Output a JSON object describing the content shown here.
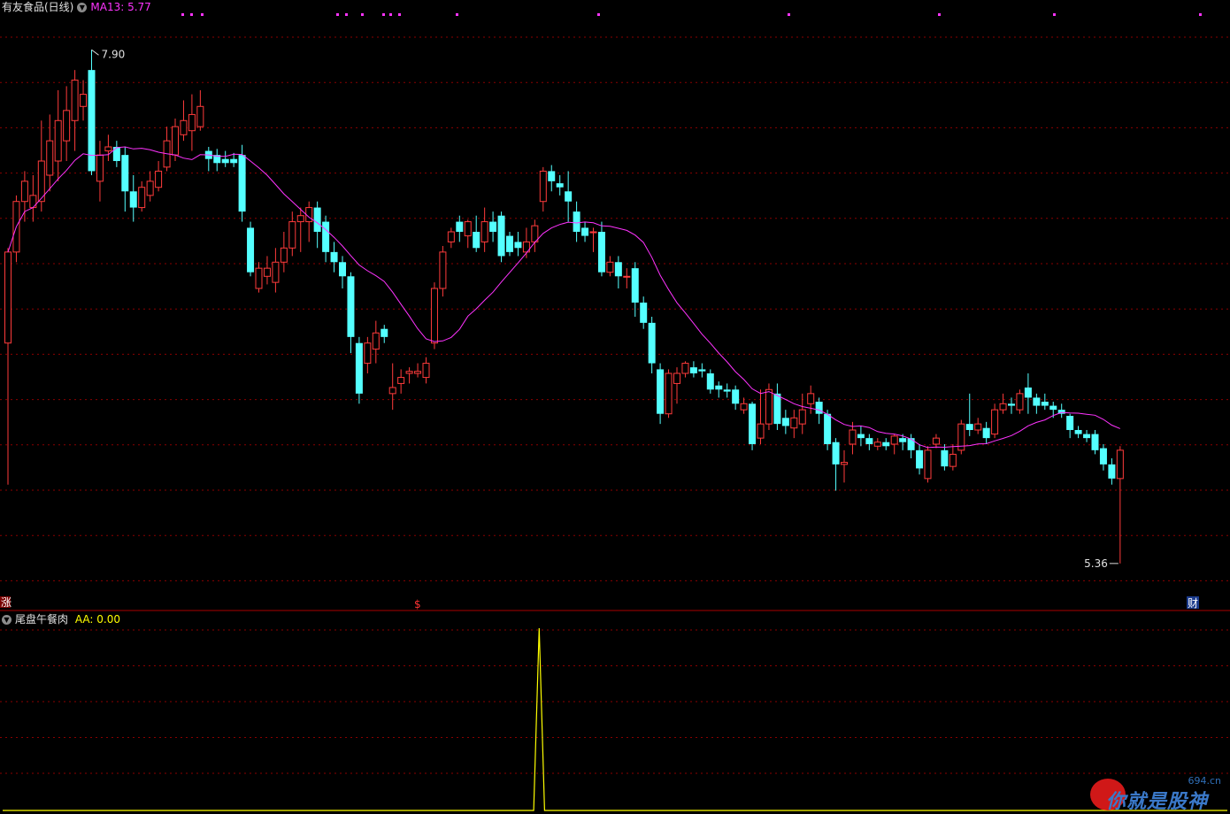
{
  "header": {
    "stock_title": "有友食品(日线)",
    "ma_label": "MA13: 5.77",
    "indicator_name": "尾盘午餐肉",
    "indicator_value": "AA: 0.00"
  },
  "markers": {
    "high_label": "7.90",
    "low_label": "5.36",
    "left_mark": "涨",
    "mid_mark": "$",
    "right_mark": "财"
  },
  "watermark": {
    "site": "694.cn",
    "text": "你就是股神"
  },
  "colors": {
    "up": "#ff3b3b",
    "down": "#54ffff",
    "ma": "#ff33ff",
    "indicator": "#ffff00",
    "grid": "#8b0000",
    "separator": "#aa0000"
  },
  "chart_data": [
    {
      "type": "candlestick",
      "title": "有友食品(日线)",
      "ylim": [
        5.25,
        8.05
      ],
      "ma13_last": 5.77,
      "candles": [
        {
          "o": 6.45,
          "c": 6.9,
          "h": 6.92,
          "l": 5.75
        },
        {
          "o": 6.9,
          "c": 7.15,
          "h": 7.18,
          "l": 6.85
        },
        {
          "o": 7.15,
          "c": 7.25,
          "h": 7.3,
          "l": 7.05
        },
        {
          "o": 7.12,
          "c": 7.18,
          "h": 7.28,
          "l": 7.05
        },
        {
          "o": 7.15,
          "c": 7.35,
          "h": 7.55,
          "l": 7.1
        },
        {
          "o": 7.28,
          "c": 7.45,
          "h": 7.58,
          "l": 7.2
        },
        {
          "o": 7.35,
          "c": 7.55,
          "h": 7.7,
          "l": 7.25
        },
        {
          "o": 7.45,
          "c": 7.6,
          "h": 7.72,
          "l": 7.35
        },
        {
          "o": 7.55,
          "c": 7.75,
          "h": 7.8,
          "l": 7.4
        },
        {
          "o": 7.62,
          "c": 7.68,
          "h": 7.75,
          "l": 7.55
        },
        {
          "o": 7.8,
          "c": 7.3,
          "h": 7.9,
          "l": 7.28
        },
        {
          "o": 7.25,
          "c": 7.38,
          "h": 7.45,
          "l": 7.15
        },
        {
          "o": 7.4,
          "c": 7.42,
          "h": 7.48,
          "l": 7.35
        },
        {
          "o": 7.42,
          "c": 7.35,
          "h": 7.45,
          "l": 7.32
        },
        {
          "o": 7.38,
          "c": 7.2,
          "h": 7.42,
          "l": 7.1
        },
        {
          "o": 7.2,
          "c": 7.12,
          "h": 7.28,
          "l": 7.05
        },
        {
          "o": 7.12,
          "c": 7.22,
          "h": 7.25,
          "l": 7.1
        },
        {
          "o": 7.18,
          "c": 7.25,
          "h": 7.3,
          "l": 7.15
        },
        {
          "o": 7.22,
          "c": 7.3,
          "h": 7.35,
          "l": 7.2
        },
        {
          "o": 7.32,
          "c": 7.45,
          "h": 7.52,
          "l": 7.3
        },
        {
          "o": 7.38,
          "c": 7.52,
          "h": 7.56,
          "l": 7.35
        },
        {
          "o": 7.48,
          "c": 7.55,
          "h": 7.65,
          "l": 7.45
        },
        {
          "o": 7.5,
          "c": 7.58,
          "h": 7.68,
          "l": 7.4
        },
        {
          "o": 7.52,
          "c": 7.62,
          "h": 7.7,
          "l": 7.5
        },
        {
          "o": 7.4,
          "c": 7.36,
          "h": 7.42,
          "l": 7.3
        },
        {
          "o": 7.38,
          "c": 7.34,
          "h": 7.41,
          "l": 7.3
        },
        {
          "o": 7.36,
          "c": 7.34,
          "h": 7.4,
          "l": 7.32
        },
        {
          "o": 7.36,
          "c": 7.34,
          "h": 7.39,
          "l": 7.32
        },
        {
          "o": 7.38,
          "c": 7.1,
          "h": 7.43,
          "l": 7.05
        },
        {
          "o": 7.02,
          "c": 6.8,
          "h": 7.05,
          "l": 6.78
        },
        {
          "o": 6.72,
          "c": 6.82,
          "h": 6.85,
          "l": 6.7
        },
        {
          "o": 6.78,
          "c": 6.82,
          "h": 6.88,
          "l": 6.74
        },
        {
          "o": 6.75,
          "c": 6.85,
          "h": 6.92,
          "l": 6.7
        },
        {
          "o": 6.85,
          "c": 6.92,
          "h": 7.0,
          "l": 6.8
        },
        {
          "o": 6.92,
          "c": 7.05,
          "h": 7.1,
          "l": 6.88
        },
        {
          "o": 7.05,
          "c": 7.08,
          "h": 7.12,
          "l": 6.9
        },
        {
          "o": 7.05,
          "c": 7.12,
          "h": 7.15,
          "l": 6.95
        },
        {
          "o": 7.12,
          "c": 7.0,
          "h": 7.15,
          "l": 6.92
        },
        {
          "o": 7.05,
          "c": 6.9,
          "h": 7.08,
          "l": 6.85
        },
        {
          "o": 6.9,
          "c": 6.85,
          "h": 6.95,
          "l": 6.8
        },
        {
          "o": 6.85,
          "c": 6.78,
          "h": 6.88,
          "l": 6.72
        },
        {
          "o": 6.78,
          "c": 6.48,
          "h": 6.8,
          "l": 6.4
        },
        {
          "o": 6.45,
          "c": 6.2,
          "h": 6.48,
          "l": 6.15
        },
        {
          "o": 6.35,
          "c": 6.45,
          "h": 6.48,
          "l": 6.3
        },
        {
          "o": 6.42,
          "c": 6.5,
          "h": 6.56,
          "l": 6.35
        },
        {
          "o": 6.52,
          "c": 6.48,
          "h": 6.54,
          "l": 6.45
        },
        {
          "o": 6.2,
          "c": 6.23,
          "h": 6.35,
          "l": 6.12
        },
        {
          "o": 6.25,
          "c": 6.28,
          "h": 6.32,
          "l": 6.2
        },
        {
          "o": 6.3,
          "c": 6.31,
          "h": 6.33,
          "l": 6.25
        },
        {
          "o": 6.3,
          "c": 6.31,
          "h": 6.35,
          "l": 6.28
        },
        {
          "o": 6.28,
          "c": 6.35,
          "h": 6.38,
          "l": 6.25
        },
        {
          "o": 6.45,
          "c": 6.72,
          "h": 6.75,
          "l": 6.42
        },
        {
          "o": 6.72,
          "c": 6.9,
          "h": 6.93,
          "l": 6.68
        },
        {
          "o": 6.95,
          "c": 7.0,
          "h": 7.02,
          "l": 6.92
        },
        {
          "o": 7.05,
          "c": 7.0,
          "h": 7.08,
          "l": 6.95
        },
        {
          "o": 6.98,
          "c": 7.05,
          "h": 7.06,
          "l": 6.92
        },
        {
          "o": 7.0,
          "c": 6.92,
          "h": 7.08,
          "l": 6.9
        },
        {
          "o": 6.95,
          "c": 7.05,
          "h": 7.12,
          "l": 6.9
        },
        {
          "o": 7.05,
          "c": 7.0,
          "h": 7.1,
          "l": 6.95
        },
        {
          "o": 7.08,
          "c": 6.88,
          "h": 7.1,
          "l": 6.85
        },
        {
          "o": 6.98,
          "c": 6.9,
          "h": 7.0,
          "l": 6.88
        },
        {
          "o": 6.95,
          "c": 6.92,
          "h": 7.0,
          "l": 6.88
        },
        {
          "o": 6.9,
          "c": 6.95,
          "h": 7.02,
          "l": 6.87
        },
        {
          "o": 6.95,
          "c": 7.03,
          "h": 7.06,
          "l": 6.9
        },
        {
          "o": 7.15,
          "c": 7.3,
          "h": 7.32,
          "l": 7.1
        },
        {
          "o": 7.3,
          "c": 7.25,
          "h": 7.33,
          "l": 7.2
        },
        {
          "o": 7.24,
          "c": 7.22,
          "h": 7.28,
          "l": 7.18
        },
        {
          "o": 7.2,
          "c": 7.15,
          "h": 7.3,
          "l": 7.05
        },
        {
          "o": 7.1,
          "c": 7.0,
          "h": 7.15,
          "l": 6.95
        },
        {
          "o": 7.02,
          "c": 6.98,
          "h": 7.05,
          "l": 6.95
        },
        {
          "o": 7.0,
          "c": 7.0,
          "h": 7.02,
          "l": 6.9
        },
        {
          "o": 7.0,
          "c": 6.8,
          "h": 7.05,
          "l": 6.78
        },
        {
          "o": 6.8,
          "c": 6.85,
          "h": 6.88,
          "l": 6.78
        },
        {
          "o": 6.85,
          "c": 6.78,
          "h": 6.88,
          "l": 6.72
        },
        {
          "o": 6.78,
          "c": 6.78,
          "h": 6.82,
          "l": 6.72
        },
        {
          "o": 6.82,
          "c": 6.65,
          "h": 6.85,
          "l": 6.58
        },
        {
          "o": 6.65,
          "c": 6.55,
          "h": 6.68,
          "l": 6.52
        },
        {
          "o": 6.55,
          "c": 6.35,
          "h": 6.58,
          "l": 6.3
        },
        {
          "o": 6.32,
          "c": 6.1,
          "h": 6.35,
          "l": 6.05
        },
        {
          "o": 6.1,
          "c": 6.3,
          "h": 6.32,
          "l": 6.08
        },
        {
          "o": 6.25,
          "c": 6.3,
          "h": 6.33,
          "l": 6.15
        },
        {
          "o": 6.3,
          "c": 6.35,
          "h": 6.36,
          "l": 6.28
        },
        {
          "o": 6.33,
          "c": 6.3,
          "h": 6.36,
          "l": 6.28
        },
        {
          "o": 6.32,
          "c": 6.31,
          "h": 6.35,
          "l": 6.28
        },
        {
          "o": 6.3,
          "c": 6.22,
          "h": 6.32,
          "l": 6.2
        },
        {
          "o": 6.24,
          "c": 6.22,
          "h": 6.26,
          "l": 6.18
        },
        {
          "o": 6.22,
          "c": 6.21,
          "h": 6.25,
          "l": 6.18
        },
        {
          "o": 6.22,
          "c": 6.15,
          "h": 6.24,
          "l": 6.12
        },
        {
          "o": 6.12,
          "c": 6.15,
          "h": 6.18,
          "l": 6.1
        },
        {
          "o": 6.15,
          "c": 5.95,
          "h": 6.16,
          "l": 5.92
        },
        {
          "o": 5.98,
          "c": 6.05,
          "h": 6.22,
          "l": 5.95
        },
        {
          "o": 6.05,
          "c": 6.22,
          "h": 6.25,
          "l": 6.02
        },
        {
          "o": 6.2,
          "c": 6.05,
          "h": 6.25,
          "l": 6.02
        },
        {
          "o": 6.08,
          "c": 6.04,
          "h": 6.12,
          "l": 6.0
        },
        {
          "o": 6.03,
          "c": 6.08,
          "h": 6.12,
          "l": 5.98
        },
        {
          "o": 6.05,
          "c": 6.12,
          "h": 6.2,
          "l": 6.0
        },
        {
          "o": 6.15,
          "c": 6.2,
          "h": 6.24,
          "l": 6.1
        },
        {
          "o": 6.16,
          "c": 6.1,
          "h": 6.18,
          "l": 6.05
        },
        {
          "o": 6.1,
          "c": 5.95,
          "h": 6.12,
          "l": 5.92
        },
        {
          "o": 5.96,
          "c": 5.85,
          "h": 5.98,
          "l": 5.72
        },
        {
          "o": 5.85,
          "c": 5.86,
          "h": 5.92,
          "l": 5.76
        },
        {
          "o": 5.95,
          "c": 6.02,
          "h": 6.06,
          "l": 5.9
        },
        {
          "o": 6.0,
          "c": 5.98,
          "h": 6.04,
          "l": 5.94
        },
        {
          "o": 5.98,
          "c": 5.95,
          "h": 6.0,
          "l": 5.92
        },
        {
          "o": 5.94,
          "c": 5.96,
          "h": 5.98,
          "l": 5.92
        },
        {
          "o": 5.96,
          "c": 5.94,
          "h": 5.98,
          "l": 5.92
        },
        {
          "o": 5.95,
          "c": 5.99,
          "h": 6.0,
          "l": 5.9
        },
        {
          "o": 5.98,
          "c": 5.96,
          "h": 6.0,
          "l": 5.92
        },
        {
          "o": 5.98,
          "c": 5.92,
          "h": 6.0,
          "l": 5.88
        },
        {
          "o": 5.92,
          "c": 5.83,
          "h": 5.95,
          "l": 5.8
        },
        {
          "o": 5.78,
          "c": 5.92,
          "h": 5.94,
          "l": 5.76
        },
        {
          "o": 5.95,
          "c": 5.98,
          "h": 6.0,
          "l": 5.93
        },
        {
          "o": 5.92,
          "c": 5.84,
          "h": 5.95,
          "l": 5.82
        },
        {
          "o": 5.84,
          "c": 5.9,
          "h": 5.95,
          "l": 5.82
        },
        {
          "o": 5.92,
          "c": 6.05,
          "h": 6.07,
          "l": 5.9
        },
        {
          "o": 6.05,
          "c": 6.02,
          "h": 6.2,
          "l": 5.99
        },
        {
          "o": 6.02,
          "c": 6.05,
          "h": 6.08,
          "l": 6.0
        },
        {
          "o": 6.03,
          "c": 5.98,
          "h": 6.06,
          "l": 5.95
        },
        {
          "o": 6.0,
          "c": 6.12,
          "h": 6.15,
          "l": 5.98
        },
        {
          "o": 6.12,
          "c": 6.15,
          "h": 6.2,
          "l": 6.1
        },
        {
          "o": 6.15,
          "c": 6.14,
          "h": 6.18,
          "l": 6.1
        },
        {
          "o": 6.12,
          "c": 6.2,
          "h": 6.22,
          "l": 6.1
        },
        {
          "o": 6.23,
          "c": 6.18,
          "h": 6.3,
          "l": 6.1
        },
        {
          "o": 6.18,
          "c": 6.14,
          "h": 6.2,
          "l": 6.1
        },
        {
          "o": 6.16,
          "c": 6.14,
          "h": 6.2,
          "l": 6.12
        },
        {
          "o": 6.14,
          "c": 6.12,
          "h": 6.16,
          "l": 6.08
        },
        {
          "o": 6.12,
          "c": 6.1,
          "h": 6.15,
          "l": 6.08
        },
        {
          "o": 6.09,
          "c": 6.02,
          "h": 6.1,
          "l": 5.98
        },
        {
          "o": 6.02,
          "c": 6.0,
          "h": 6.04,
          "l": 5.98
        },
        {
          "o": 6.0,
          "c": 5.98,
          "h": 6.02,
          "l": 5.96
        },
        {
          "o": 6.0,
          "c": 5.92,
          "h": 6.02,
          "l": 5.9
        },
        {
          "o": 5.93,
          "c": 5.85,
          "h": 5.95,
          "l": 5.82
        },
        {
          "o": 5.85,
          "c": 5.78,
          "h": 5.88,
          "l": 5.75
        },
        {
          "o": 5.78,
          "c": 5.92,
          "h": 5.94,
          "l": 5.36
        }
      ]
    },
    {
      "type": "line",
      "title": "尾盘午餐肉",
      "ylim": [
        0,
        1
      ],
      "series": [
        {
          "name": "AA",
          "values": [
            0,
            0,
            0,
            0,
            0,
            0,
            0,
            0,
            0,
            0,
            0,
            0,
            0,
            0,
            0,
            0,
            0,
            0,
            0,
            0,
            0,
            0,
            0,
            0,
            0,
            0,
            0,
            0,
            0,
            0,
            0,
            0,
            0,
            0,
            0,
            0,
            0,
            0,
            0,
            0,
            0,
            0,
            0,
            0,
            0,
            0,
            0,
            0,
            0,
            0,
            0,
            0,
            0,
            0,
            0,
            0,
            0,
            0,
            0,
            0,
            0,
            0,
            0,
            0,
            0,
            0,
            0,
            0,
            0,
            0,
            0,
            0,
            0,
            0,
            0,
            0,
            0,
            0,
            0,
            0,
            0,
            0,
            0,
            0,
            0,
            0,
            0,
            0,
            0,
            0,
            0,
            0,
            0,
            0,
            0,
            0,
            0,
            0,
            0,
            1,
            0,
            0,
            0,
            0,
            0,
            0,
            0,
            0,
            0,
            0,
            0,
            0,
            0,
            0,
            0,
            0,
            0,
            0,
            0,
            0,
            0,
            0,
            0,
            0,
            0,
            0,
            0,
            0,
            0,
            0,
            0,
            0,
            0,
            0,
            0,
            0,
            0,
            0,
            0,
            0,
            0,
            0,
            0,
            0,
            0,
            0,
            0,
            0,
            0,
            0,
            0,
            0,
            0,
            0,
            0,
            0,
            0,
            0,
            0,
            0,
            0,
            0,
            0,
            0,
            0,
            0,
            0,
            0,
            0,
            0,
            0,
            0,
            0,
            0,
            0,
            0,
            0,
            0,
            0,
            0,
            0,
            0,
            0,
            0,
            0,
            0,
            0,
            0,
            0,
            0,
            0,
            0,
            0,
            0,
            0,
            0,
            0,
            0,
            0,
            0,
            0,
            0,
            0,
            0,
            0,
            0,
            0,
            0,
            0,
            0,
            0,
            0,
            0,
            0,
            0,
            0,
            0,
            0,
            0,
            0,
            0,
            0,
            0,
            0,
            0,
            0,
            0
          ]
        }
      ]
    }
  ]
}
